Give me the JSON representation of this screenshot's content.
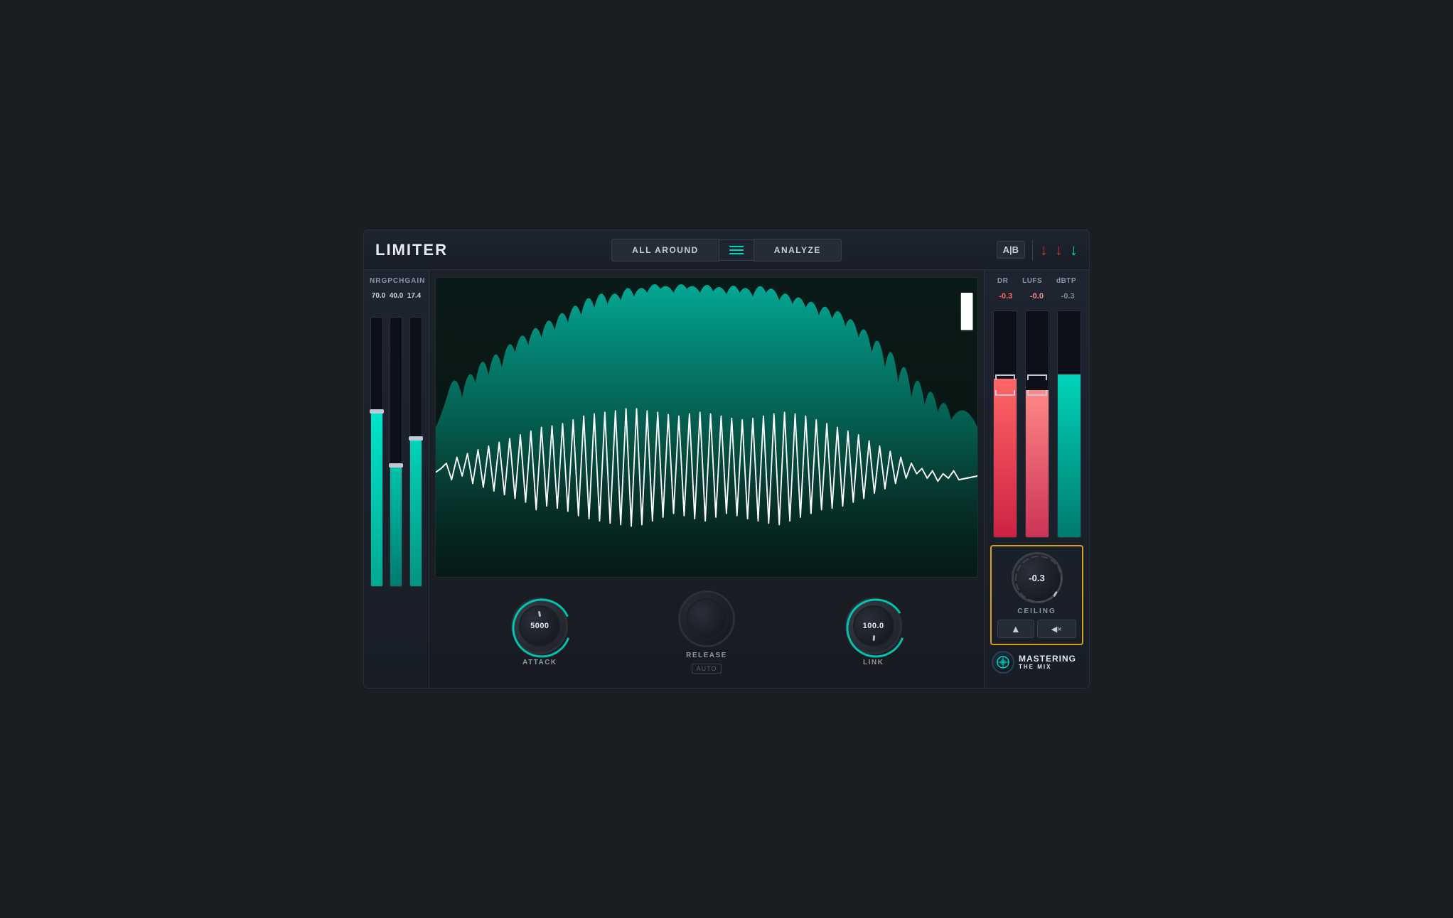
{
  "header": {
    "title": "LIMITER",
    "preset": "ALL AROUND",
    "analyze": "ANALYZE",
    "ab": "A|B"
  },
  "left_panel": {
    "labels": [
      "NRG",
      "PCH",
      "GAIN"
    ],
    "values": [
      "70.0",
      "40.0",
      "17.4"
    ]
  },
  "controls": {
    "attack_label": "ATTACK",
    "attack_value": "5000",
    "release_label": "RELEASE",
    "release_sublabel": "AUTO",
    "link_label": "LINK",
    "link_value": "100.0"
  },
  "right_meters": {
    "headers": [
      "DR",
      "LUFS",
      "dBTP"
    ],
    "values": [
      "-0.3",
      "-0.0",
      "-0.3"
    ]
  },
  "ceiling": {
    "value": "-0.3",
    "label": "CEILING",
    "btn_triangle": "▲",
    "btn_mute": "◀×"
  },
  "branding": {
    "main": "MASTERING",
    "sub": "THE MIX"
  },
  "icons": {
    "hamburger": "≡",
    "arrow_down_red": "↓",
    "arrow_down_teal": "↓",
    "globe": "⊕",
    "question": "?",
    "headphones": "🎧"
  }
}
